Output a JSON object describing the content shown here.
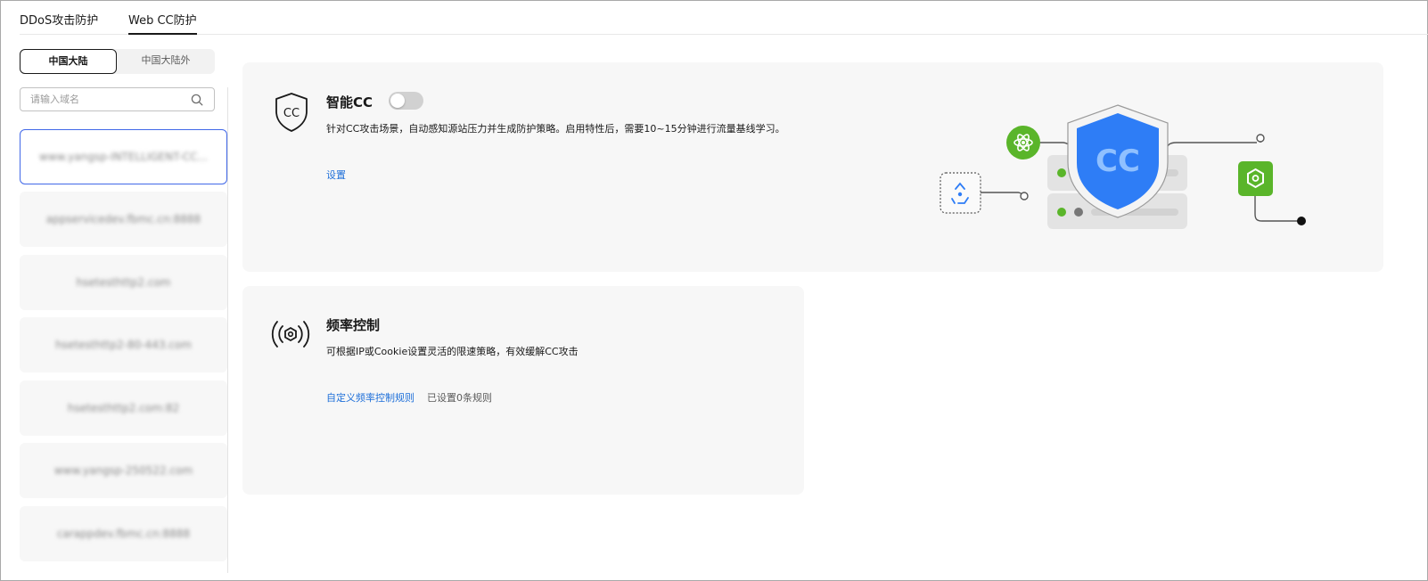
{
  "top_tabs": [
    {
      "label": "DDoS攻击防护",
      "active": false
    },
    {
      "label": "Web CC防护",
      "active": true
    }
  ],
  "region_switch": {
    "options": [
      "中国大陆",
      "中国大陆外"
    ],
    "selected": "中国大陆"
  },
  "search": {
    "placeholder": "请输入域名",
    "value": ""
  },
  "domains": [
    {
      "name": "www.yangsp-INTELLIGENT-CC...",
      "selected": true
    },
    {
      "name": "appservicedev.fbmc.cn:8888",
      "selected": false
    },
    {
      "name": "hsetesthttp2.com",
      "selected": false
    },
    {
      "name": "hsetesthttp2-80-443.com",
      "selected": false
    },
    {
      "name": "hsetesthttp2.com:82",
      "selected": false
    },
    {
      "name": "www.yangsp-250522.com",
      "selected": false
    },
    {
      "name": "carappdev.fbmc.cn:8888",
      "selected": false
    }
  ],
  "smart_cc": {
    "icon": "shield-cc-icon",
    "title": "智能CC",
    "enabled": false,
    "description": "针对CC攻击场景，自动感知源站压力并生成防护策略。启用特性后，需要10~15分钟进行流量基线学习。",
    "settings_link": "设置",
    "illustration": {
      "shield_text": "CC",
      "accent": "#2e7df6",
      "green": "#5ab52a"
    }
  },
  "rate_control": {
    "icon": "broadcast-icon",
    "title": "频率控制",
    "description": "可根据IP或Cookie设置灵活的限速策略，有效缓解CC攻击",
    "custom_rules_link": "自定义频率控制规则",
    "rules_status": "已设置0条规则"
  }
}
